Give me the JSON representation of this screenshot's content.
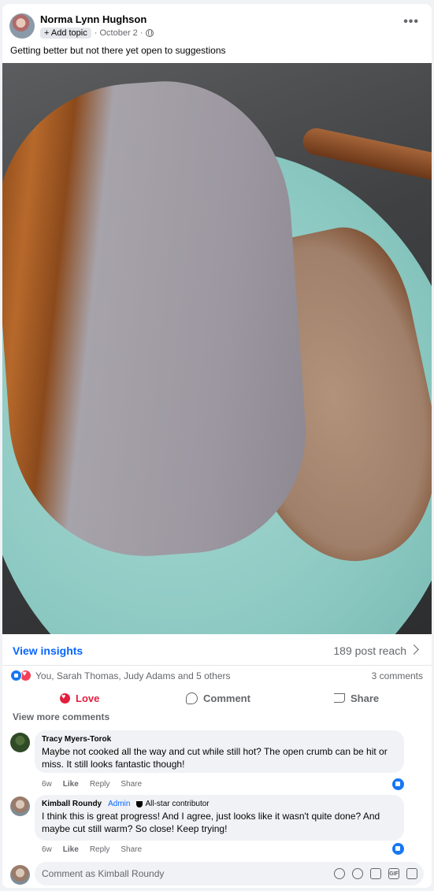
{
  "post": {
    "author": "Norma Lynn Hughson",
    "topic_label": "+ Add topic",
    "date": "October 2",
    "caption": "Getting better but not there yet open to suggestions"
  },
  "insights": {
    "link": "View insights",
    "reach": "189 post reach"
  },
  "reactions": {
    "names": "You, Sarah Thomas, Judy Adams and 5 others",
    "comment_count": "3 comments"
  },
  "actions": {
    "love": "Love",
    "comment": "Comment",
    "share": "Share"
  },
  "view_more_comments": "View more comments",
  "comments": [
    {
      "name": "Tracy Myers-Torok",
      "text": "Maybe not cooked all the way and cut while still hot? The open crumb can be hit or miss. It still looks fantastic though!",
      "time": "6w",
      "like": "Like",
      "reply": "Reply",
      "share": "Share"
    },
    {
      "name": "Kimball Roundy",
      "badge_admin": "Admin",
      "badge_allstar": "All-star contributor",
      "text": "I think this is great progress! And I agree, just looks like it wasn't quite done? And maybe cut still warm? So close! Keep trying!",
      "time": "6w",
      "like": "Like",
      "reply": "Reply",
      "share": "Share"
    }
  ],
  "composer": {
    "placeholder": "Comment as Kimball Roundy",
    "gif_label": "GIF"
  },
  "colors": {
    "accent_blue": "#0866ff",
    "love_red": "#e41e3f",
    "secondary_text": "#65676b",
    "bubble_bg": "#f0f2f5"
  },
  "icons": [
    "more-icon",
    "globe-icon",
    "love-icon",
    "comment-icon",
    "share-icon",
    "chevron-right-icon",
    "like-reaction-icon",
    "heart-reaction-icon",
    "trophy-icon",
    "emoji-icon",
    "camera-icon",
    "gif-icon",
    "sticker-icon",
    "avatar-icon"
  ]
}
